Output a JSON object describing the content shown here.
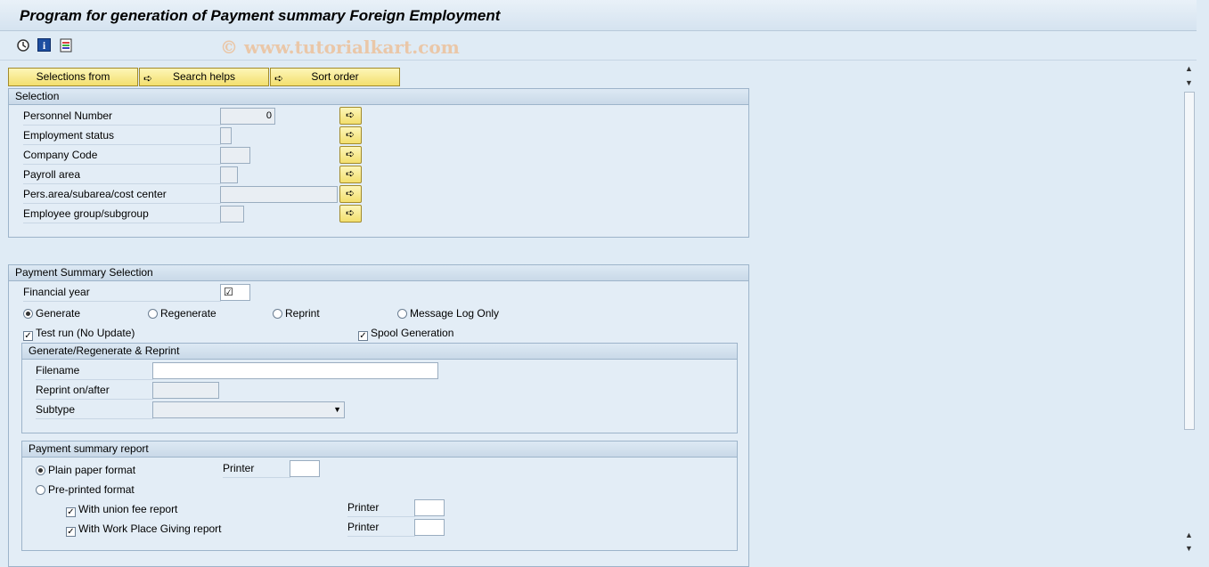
{
  "window": {
    "title": "Program for generation of Payment summary Foreign Employment"
  },
  "toolbar": {
    "icons": [
      "execute-icon",
      "info-icon",
      "variant-icon"
    ],
    "watermark": "© www.tutorialkart.com"
  },
  "buttons": {
    "selections_from": "Selections from",
    "search_helps": "Search helps",
    "sort_order": "Sort order"
  },
  "selection": {
    "title": "Selection",
    "personnel_number": {
      "label": "Personnel Number",
      "value": "0"
    },
    "employment_status": {
      "label": "Employment status",
      "value": ""
    },
    "company_code": {
      "label": "Company Code",
      "value": ""
    },
    "payroll_area": {
      "label": "Payroll area",
      "value": ""
    },
    "pers_area": {
      "label": "Pers.area/subarea/cost center",
      "value": ""
    },
    "employee_group": {
      "label": "Employee group/subgroup",
      "value": ""
    }
  },
  "payment_summary": {
    "title": "Payment Summary Selection",
    "financial_year": {
      "label": "Financial year",
      "checked": true
    },
    "radios": [
      {
        "label": "Generate",
        "selected": true
      },
      {
        "label": "Regenerate",
        "selected": false
      },
      {
        "label": "Reprint",
        "selected": false
      },
      {
        "label": "Message Log Only",
        "selected": false
      }
    ],
    "test_run": {
      "label": "Test run (No Update)",
      "checked": true
    },
    "spool_generation": {
      "label": "Spool Generation",
      "checked": true
    },
    "generate_group": {
      "title": "Generate/Regenerate & Reprint",
      "filename": {
        "label": "Filename",
        "value": ""
      },
      "reprint_on_after": {
        "label": "Reprint on/after",
        "value": ""
      },
      "subtype": {
        "label": "Subtype",
        "value": ""
      }
    },
    "report_group": {
      "title": "Payment summary report",
      "plain_paper": {
        "label": "Plain paper format",
        "selected": true
      },
      "pre_printed": {
        "label": "Pre-printed format",
        "selected": false
      },
      "printer_label": "Printer",
      "union_fee": {
        "label": "With union fee report",
        "checked": true
      },
      "work_place_giving": {
        "label": "With Work Place Giving report",
        "checked": true
      }
    }
  },
  "colors": {
    "background": "#dfebf5",
    "button": "#f3df6e",
    "group_border": "#9db4ca"
  }
}
